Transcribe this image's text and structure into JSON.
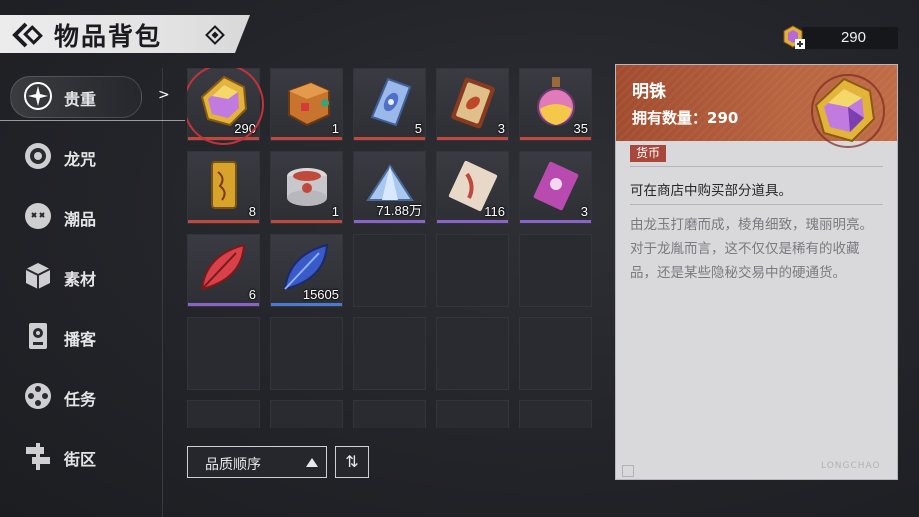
{
  "header": {
    "title": "物品背包",
    "currency_value": "290"
  },
  "sidebar": {
    "items": [
      {
        "label": "贵重",
        "icon": "sparkle-icon"
      },
      {
        "label": "龙咒",
        "icon": "spiral-icon"
      },
      {
        "label": "潮品",
        "icon": "mask-icon"
      },
      {
        "label": "素材",
        "icon": "cube-icon"
      },
      {
        "label": "播客",
        "icon": "speaker-icon"
      },
      {
        "label": "任务",
        "icon": "film-reel-icon"
      },
      {
        "label": "街区",
        "icon": "street-sign-icon"
      }
    ],
    "active_index": 0
  },
  "grid": {
    "items": [
      {
        "name": "gem",
        "qty": "290",
        "rarity": "red"
      },
      {
        "name": "treasure-box",
        "qty": "1",
        "rarity": "red"
      },
      {
        "name": "eye-crystal",
        "qty": "5",
        "rarity": "red"
      },
      {
        "name": "card",
        "qty": "3",
        "rarity": "red"
      },
      {
        "name": "potion",
        "qty": "35",
        "rarity": "red"
      },
      {
        "name": "talisman",
        "qty": "8",
        "rarity": "red"
      },
      {
        "name": "can",
        "qty": "1",
        "rarity": "red"
      },
      {
        "name": "crystal-pile",
        "qty": "71.88万",
        "rarity": "purple"
      },
      {
        "name": "ticket",
        "qty": "116",
        "rarity": "purple"
      },
      {
        "name": "voucher",
        "qty": "3",
        "rarity": "purple"
      },
      {
        "name": "red-leaf",
        "qty": "6",
        "rarity": "purple"
      },
      {
        "name": "blue-leaf",
        "qty": "15605",
        "rarity": "blue"
      }
    ],
    "rarity_colors": {
      "red": "#c0483c",
      "purple": "#8a63c9",
      "blue": "#4a7bd0"
    }
  },
  "controls": {
    "sort_label": "品质顺序",
    "order_symbol": "⇅"
  },
  "detail": {
    "name": "明铢",
    "owned": "拥有数量：290",
    "tag": "货币",
    "usage": "可在商店中购买部分道具。",
    "description": "由龙玉打磨而成，棱角细致，瑰丽明亮。对于龙胤而言，这不仅仅是稀有的收藏品，还是某些隐秘交易中的硬通货。",
    "watermark": "LONGCHAO"
  }
}
